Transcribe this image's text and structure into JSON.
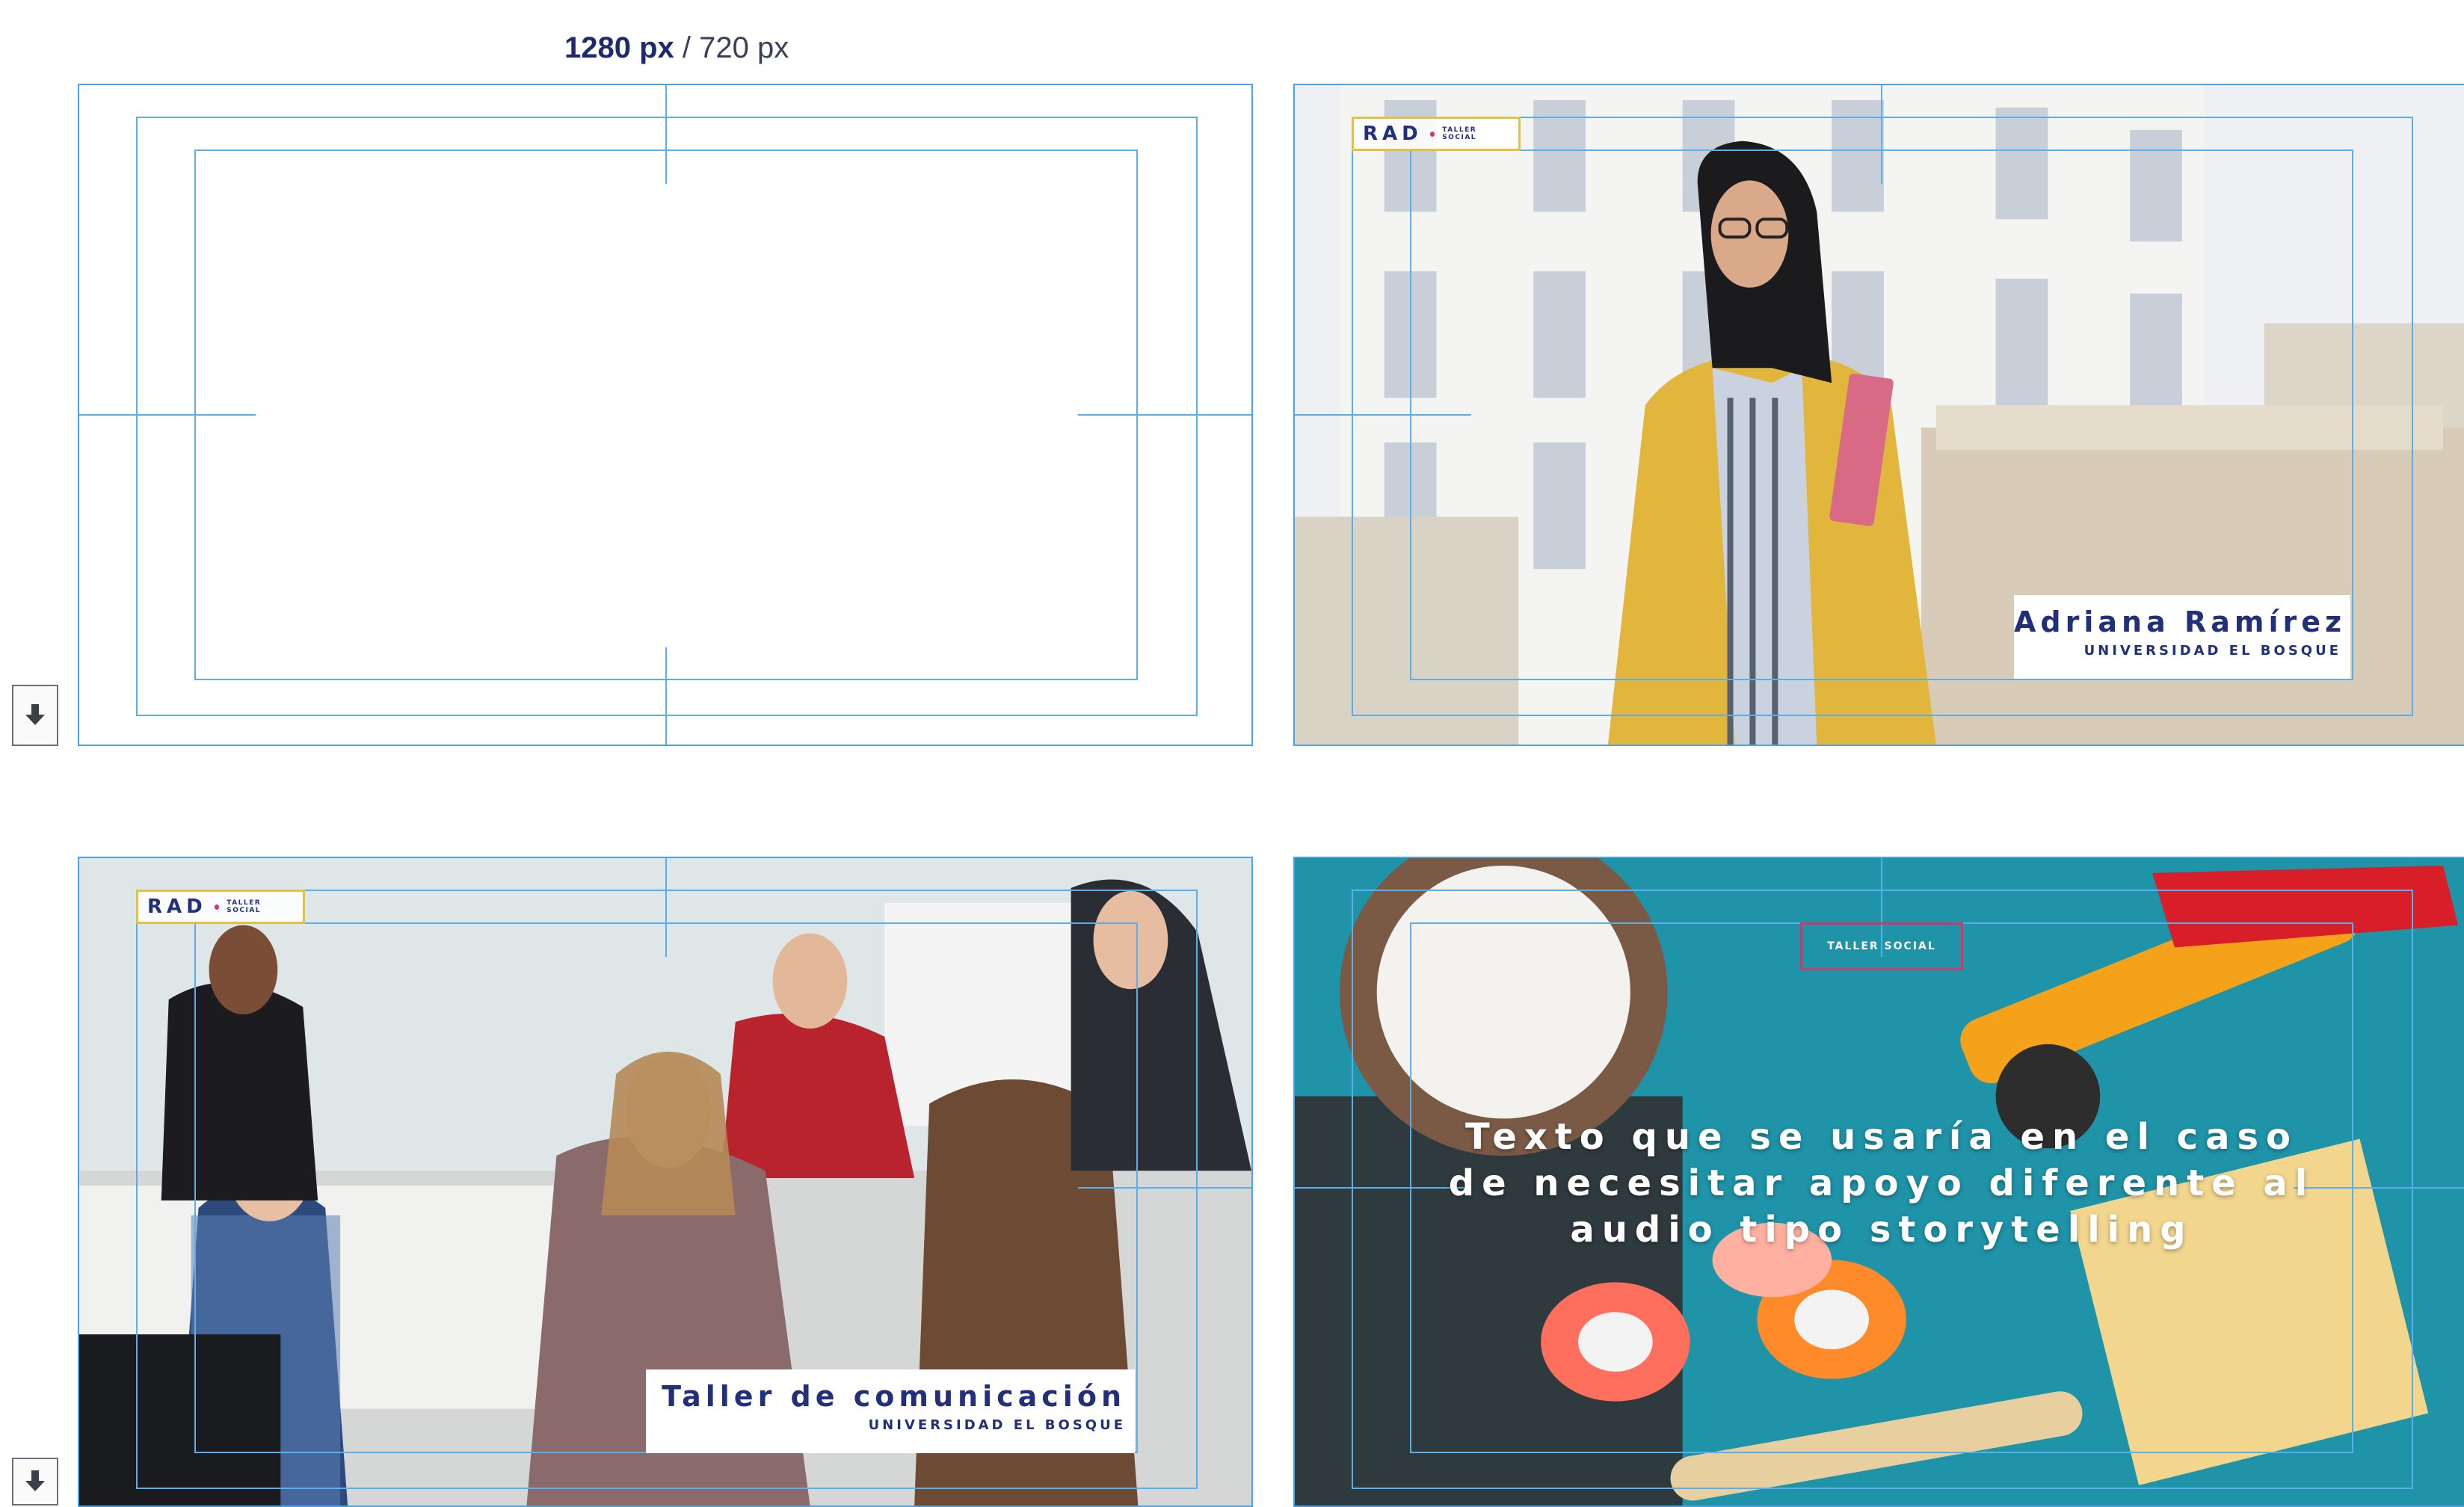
{
  "caption": {
    "width_label": "1280 px",
    "separator": " / ",
    "height_label": "720 px"
  },
  "logo": {
    "mark": "RAD",
    "subtitle": "TALLER SOCIAL"
  },
  "slide_person": {
    "name": "Adriana Ramírez",
    "university": "UNIVERSIDAD EL BOSQUE"
  },
  "slide_workshop": {
    "title": "Taller de comunicación",
    "university": "UNIVERSIDAD EL BOSQUE"
  },
  "slide_story": {
    "badge": "TALLER SOCIAL",
    "lines": [
      "Texto que se usaría en el caso",
      "de necesitar apoyo diferente al",
      "audio tipo storytelling"
    ]
  },
  "colors": {
    "guide": "#5aaee9",
    "brand_navy": "#22307a",
    "logo_border": "#e3c240",
    "accent_pink": "#e0306a"
  },
  "icons": {
    "download": "download-icon"
  }
}
